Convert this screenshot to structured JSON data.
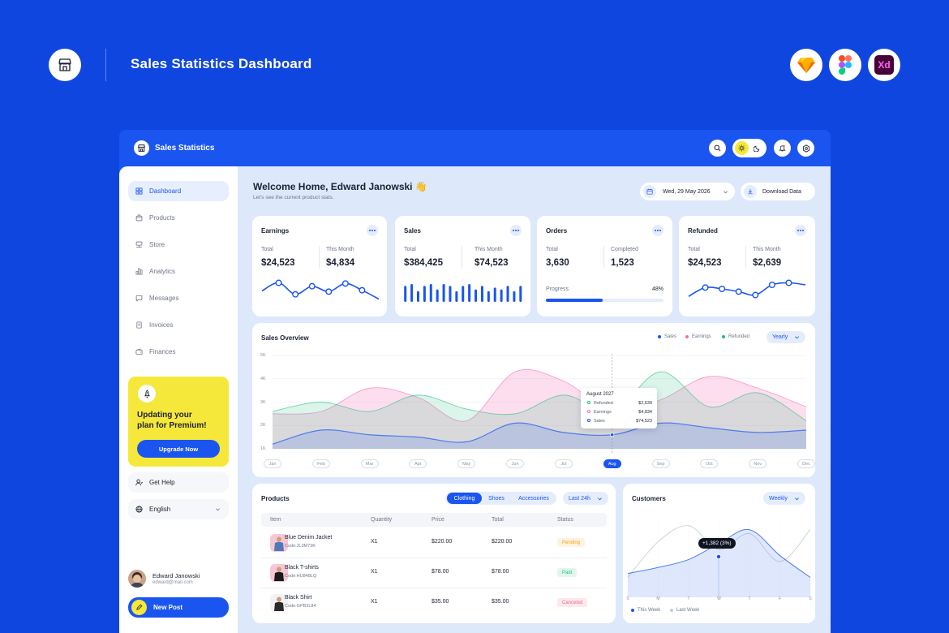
{
  "outer": {
    "title": "Sales Statistics Dashboard",
    "tools": [
      "sketch-icon",
      "figma-icon",
      "xd-icon"
    ],
    "xd_label": "Xd"
  },
  "topbar": {
    "title": "Sales Statistics"
  },
  "sidebar": {
    "items": [
      {
        "label": "Dashboard",
        "icon": "grid-icon",
        "active": true
      },
      {
        "label": "Products",
        "icon": "box-icon"
      },
      {
        "label": "Store",
        "icon": "store-icon"
      },
      {
        "label": "Analytics",
        "icon": "bar-chart-icon"
      },
      {
        "label": "Messages",
        "icon": "message-icon"
      },
      {
        "label": "Invoices",
        "icon": "invoice-icon"
      },
      {
        "label": "Finances",
        "icon": "wallet-icon"
      }
    ],
    "promo": {
      "line1": "Updating your",
      "line2": "plan for Premium!",
      "button": "Upgrade Now"
    },
    "help": "Get Help",
    "language": "English",
    "user": {
      "name": "Edward Janowski",
      "email": "edward@mail.com"
    },
    "new_post": "New Post"
  },
  "header": {
    "welcome": "Welcome Home, Edward Janowski",
    "emoji": "👋",
    "subtitle": "Let's see the current product stats.",
    "date": "Wed, 29 May 2026",
    "download": "Download Data"
  },
  "stats": {
    "earnings": {
      "title": "Earnings",
      "l1": "Total",
      "v1": "$24,523",
      "l2": "This Month",
      "v2": "$4,834",
      "trend": [
        2.1,
        3.3,
        1.6,
        2.8,
        2.0,
        3.2,
        2.2,
        0.9
      ]
    },
    "sales": {
      "title": "Sales",
      "l1": "Total",
      "v1": "$384,425",
      "l2": "This Month",
      "v2": "$74,523",
      "bars": [
        0.9,
        1.0,
        0.6,
        0.9,
        1.0,
        0.7,
        1.0,
        0.9,
        0.6,
        0.9,
        1.0,
        0.7,
        0.9,
        0.6,
        0.8,
        0.7,
        0.9,
        0.6,
        0.9
      ]
    },
    "orders": {
      "title": "Orders",
      "l1": "Total",
      "v1": "3,630",
      "l2": "Completed",
      "v2": "1,523",
      "progress_label": "Progress",
      "progress_text": "48%",
      "progress": 0.48
    },
    "refunded": {
      "title": "Refunded",
      "l1": "Total",
      "v1": "$24,523",
      "l2": "This Month",
      "v2": "$2,639",
      "trend": [
        1.3,
        2.6,
        2.4,
        2.0,
        1.5,
        3.0,
        3.3,
        3.0
      ]
    }
  },
  "overview": {
    "title": "Sales Overview",
    "legend": [
      {
        "name": "Sales",
        "color": "#1a55f0"
      },
      {
        "name": "Earnings",
        "color": "#f46bb5"
      },
      {
        "name": "Refunded",
        "color": "#1fbf7a"
      }
    ],
    "range": "Yearly",
    "tooltip": {
      "title": "August 2027",
      "rows": [
        {
          "name": "Refunded",
          "value": "$2,639"
        },
        {
          "name": "Earnings",
          "value": "$4,834"
        },
        {
          "name": "Sales",
          "value": "$74,523"
        }
      ]
    }
  },
  "products": {
    "title": "Products",
    "tabs": [
      "Clothing",
      "Shoes",
      "Accessories"
    ],
    "range": "Last 24h",
    "columns": [
      "Item",
      "Quantity",
      "Price",
      "Total",
      "Status"
    ],
    "rows": [
      {
        "name": "Blue Denim Jacket",
        "code": "Code:JL3M73K",
        "qty": "X1",
        "price": "$220.00",
        "total": "$220.00",
        "status": "Pending"
      },
      {
        "name": "Black T-shirts",
        "code": "Code:HU848LQ",
        "qty": "X1",
        "price": "$78.00",
        "total": "$78.00",
        "status": "Paid"
      },
      {
        "name": "Black Shirt",
        "code": "Code:GPB3L84",
        "qty": "X1",
        "price": "$35.00",
        "total": "$35.00",
        "status": "Canceled"
      }
    ]
  },
  "customers": {
    "title": "Customers",
    "range": "Weekly",
    "tooltip": "+1,382 (3%)",
    "days": [
      "S",
      "M",
      "T",
      "W",
      "T",
      "F",
      "S"
    ],
    "legend": [
      "This Week",
      "Last Week"
    ]
  },
  "chart_data": [
    {
      "type": "area",
      "title": "Sales Overview",
      "categories": [
        "Jan",
        "Feb",
        "Mar",
        "Apr",
        "May",
        "Jun",
        "Jul",
        "Aug",
        "Sep",
        "Oct",
        "Nov",
        "Dec"
      ],
      "y_ticks": [
        "5K",
        "4K",
        "3K",
        "2K",
        "1K"
      ],
      "ylim": [
        1,
        5
      ],
      "series": [
        {
          "name": "Earnings",
          "values": [
            2.5,
            2.6,
            3.6,
            3.2,
            2.2,
            4.3,
            3.9,
            2.6,
            3.1,
            4.1,
            3.6,
            2.8
          ]
        },
        {
          "name": "Refunded",
          "values": [
            2.6,
            3.0,
            2.6,
            3.3,
            2.7,
            2.5,
            3.3,
            2.6,
            4.3,
            2.8,
            3.4,
            2.2
          ]
        },
        {
          "name": "Sales",
          "values": [
            1.2,
            1.8,
            1.6,
            1.5,
            1.3,
            2.1,
            1.7,
            1.6,
            2.1,
            1.9,
            1.7,
            1.8
          ]
        }
      ],
      "highlight": "Aug"
    },
    {
      "type": "line",
      "title": "Customers",
      "categories": [
        "S",
        "M",
        "T",
        "W",
        "T",
        "F",
        "S"
      ],
      "series": [
        {
          "name": "This Week",
          "values": [
            1.2,
            1.5,
            1.9,
            2.7,
            3.4,
            2.1,
            1.0
          ]
        },
        {
          "name": "Last Week",
          "values": [
            1.0,
            2.8,
            3.6,
            2.4,
            3.2,
            1.8,
            3.4
          ]
        }
      ]
    }
  ]
}
